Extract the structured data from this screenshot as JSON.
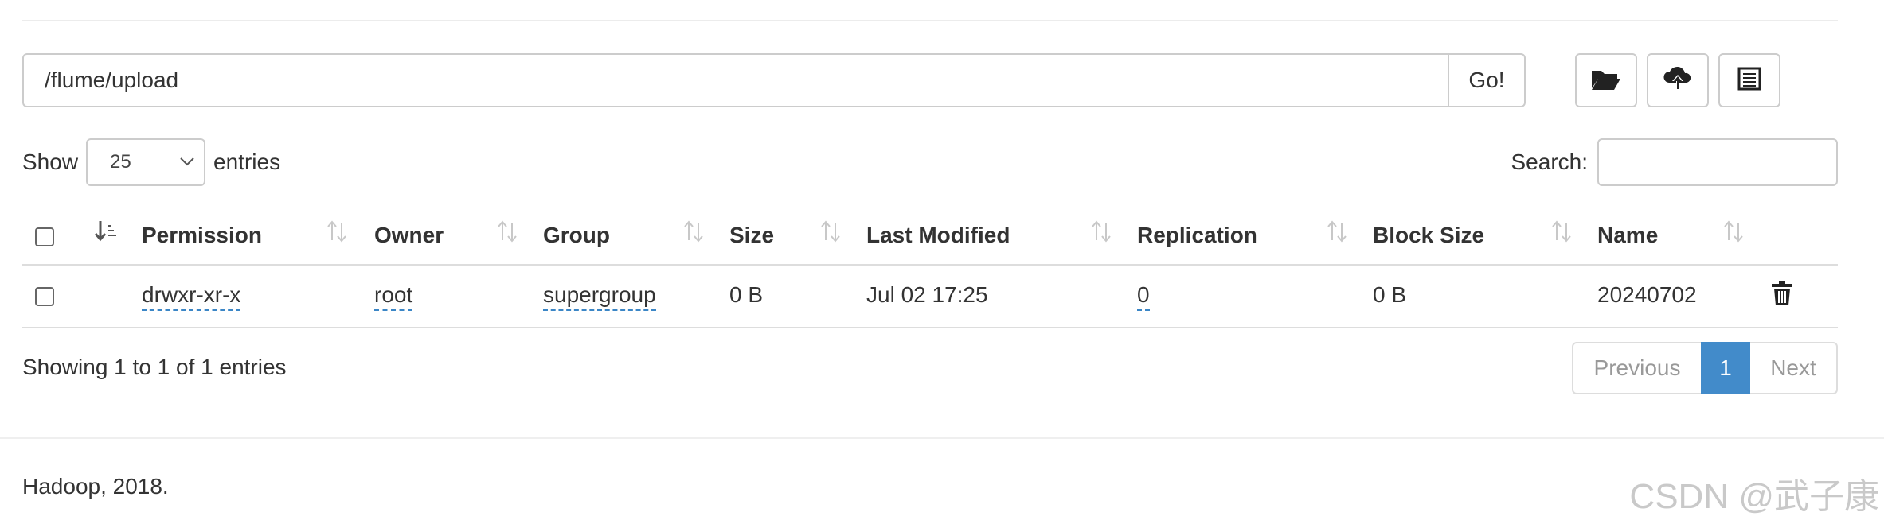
{
  "path": {
    "value": "/flume/upload",
    "go_label": "Go!"
  },
  "toolbar": {
    "icons": [
      "folder-open-icon",
      "cloud-upload-icon",
      "list-icon"
    ]
  },
  "length": {
    "show_label": "Show",
    "selected": "25",
    "entries_label": "entries"
  },
  "search": {
    "label": "Search:",
    "value": ""
  },
  "table": {
    "columns": [
      "Permission",
      "Owner",
      "Group",
      "Size",
      "Last Modified",
      "Replication",
      "Block Size",
      "Name"
    ],
    "rows": [
      {
        "permission": "drwxr-xr-x",
        "owner": "root",
        "group": "supergroup",
        "size": "0 B",
        "last_modified": "Jul 02 17:25",
        "replication": "0",
        "block_size": "0 B",
        "name": "20240702"
      }
    ]
  },
  "info": "Showing 1 to 1 of 1 entries",
  "pagination": {
    "previous": "Previous",
    "current": "1",
    "next": "Next"
  },
  "footer": "Hadoop, 2018.",
  "watermark": "CSDN @武子康",
  "colors": {
    "link": "#2f7bbd",
    "active_page": "#428bca"
  }
}
